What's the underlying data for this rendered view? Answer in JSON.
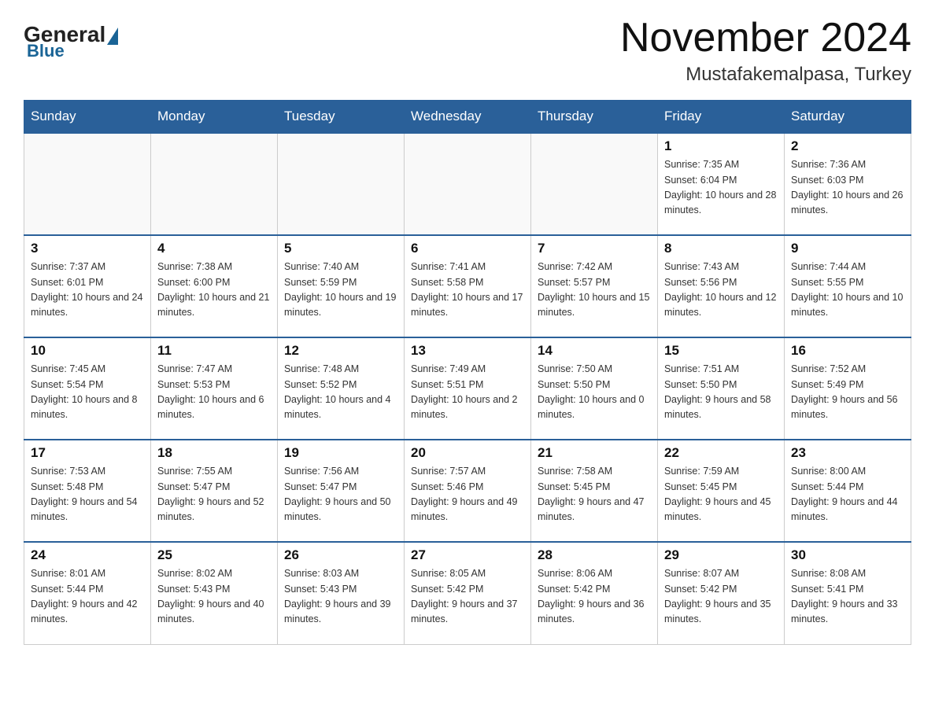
{
  "logo": {
    "general": "General",
    "blue": "Blue"
  },
  "header": {
    "month_title": "November 2024",
    "location": "Mustafakemalpasa, Turkey"
  },
  "days_of_week": [
    "Sunday",
    "Monday",
    "Tuesday",
    "Wednesday",
    "Thursday",
    "Friday",
    "Saturday"
  ],
  "weeks": [
    [
      {
        "day": "",
        "info": ""
      },
      {
        "day": "",
        "info": ""
      },
      {
        "day": "",
        "info": ""
      },
      {
        "day": "",
        "info": ""
      },
      {
        "day": "",
        "info": ""
      },
      {
        "day": "1",
        "info": "Sunrise: 7:35 AM\nSunset: 6:04 PM\nDaylight: 10 hours and 28 minutes."
      },
      {
        "day": "2",
        "info": "Sunrise: 7:36 AM\nSunset: 6:03 PM\nDaylight: 10 hours and 26 minutes."
      }
    ],
    [
      {
        "day": "3",
        "info": "Sunrise: 7:37 AM\nSunset: 6:01 PM\nDaylight: 10 hours and 24 minutes."
      },
      {
        "day": "4",
        "info": "Sunrise: 7:38 AM\nSunset: 6:00 PM\nDaylight: 10 hours and 21 minutes."
      },
      {
        "day": "5",
        "info": "Sunrise: 7:40 AM\nSunset: 5:59 PM\nDaylight: 10 hours and 19 minutes."
      },
      {
        "day": "6",
        "info": "Sunrise: 7:41 AM\nSunset: 5:58 PM\nDaylight: 10 hours and 17 minutes."
      },
      {
        "day": "7",
        "info": "Sunrise: 7:42 AM\nSunset: 5:57 PM\nDaylight: 10 hours and 15 minutes."
      },
      {
        "day": "8",
        "info": "Sunrise: 7:43 AM\nSunset: 5:56 PM\nDaylight: 10 hours and 12 minutes."
      },
      {
        "day": "9",
        "info": "Sunrise: 7:44 AM\nSunset: 5:55 PM\nDaylight: 10 hours and 10 minutes."
      }
    ],
    [
      {
        "day": "10",
        "info": "Sunrise: 7:45 AM\nSunset: 5:54 PM\nDaylight: 10 hours and 8 minutes."
      },
      {
        "day": "11",
        "info": "Sunrise: 7:47 AM\nSunset: 5:53 PM\nDaylight: 10 hours and 6 minutes."
      },
      {
        "day": "12",
        "info": "Sunrise: 7:48 AM\nSunset: 5:52 PM\nDaylight: 10 hours and 4 minutes."
      },
      {
        "day": "13",
        "info": "Sunrise: 7:49 AM\nSunset: 5:51 PM\nDaylight: 10 hours and 2 minutes."
      },
      {
        "day": "14",
        "info": "Sunrise: 7:50 AM\nSunset: 5:50 PM\nDaylight: 10 hours and 0 minutes."
      },
      {
        "day": "15",
        "info": "Sunrise: 7:51 AM\nSunset: 5:50 PM\nDaylight: 9 hours and 58 minutes."
      },
      {
        "day": "16",
        "info": "Sunrise: 7:52 AM\nSunset: 5:49 PM\nDaylight: 9 hours and 56 minutes."
      }
    ],
    [
      {
        "day": "17",
        "info": "Sunrise: 7:53 AM\nSunset: 5:48 PM\nDaylight: 9 hours and 54 minutes."
      },
      {
        "day": "18",
        "info": "Sunrise: 7:55 AM\nSunset: 5:47 PM\nDaylight: 9 hours and 52 minutes."
      },
      {
        "day": "19",
        "info": "Sunrise: 7:56 AM\nSunset: 5:47 PM\nDaylight: 9 hours and 50 minutes."
      },
      {
        "day": "20",
        "info": "Sunrise: 7:57 AM\nSunset: 5:46 PM\nDaylight: 9 hours and 49 minutes."
      },
      {
        "day": "21",
        "info": "Sunrise: 7:58 AM\nSunset: 5:45 PM\nDaylight: 9 hours and 47 minutes."
      },
      {
        "day": "22",
        "info": "Sunrise: 7:59 AM\nSunset: 5:45 PM\nDaylight: 9 hours and 45 minutes."
      },
      {
        "day": "23",
        "info": "Sunrise: 8:00 AM\nSunset: 5:44 PM\nDaylight: 9 hours and 44 minutes."
      }
    ],
    [
      {
        "day": "24",
        "info": "Sunrise: 8:01 AM\nSunset: 5:44 PM\nDaylight: 9 hours and 42 minutes."
      },
      {
        "day": "25",
        "info": "Sunrise: 8:02 AM\nSunset: 5:43 PM\nDaylight: 9 hours and 40 minutes."
      },
      {
        "day": "26",
        "info": "Sunrise: 8:03 AM\nSunset: 5:43 PM\nDaylight: 9 hours and 39 minutes."
      },
      {
        "day": "27",
        "info": "Sunrise: 8:05 AM\nSunset: 5:42 PM\nDaylight: 9 hours and 37 minutes."
      },
      {
        "day": "28",
        "info": "Sunrise: 8:06 AM\nSunset: 5:42 PM\nDaylight: 9 hours and 36 minutes."
      },
      {
        "day": "29",
        "info": "Sunrise: 8:07 AM\nSunset: 5:42 PM\nDaylight: 9 hours and 35 minutes."
      },
      {
        "day": "30",
        "info": "Sunrise: 8:08 AM\nSunset: 5:41 PM\nDaylight: 9 hours and 33 minutes."
      }
    ]
  ]
}
